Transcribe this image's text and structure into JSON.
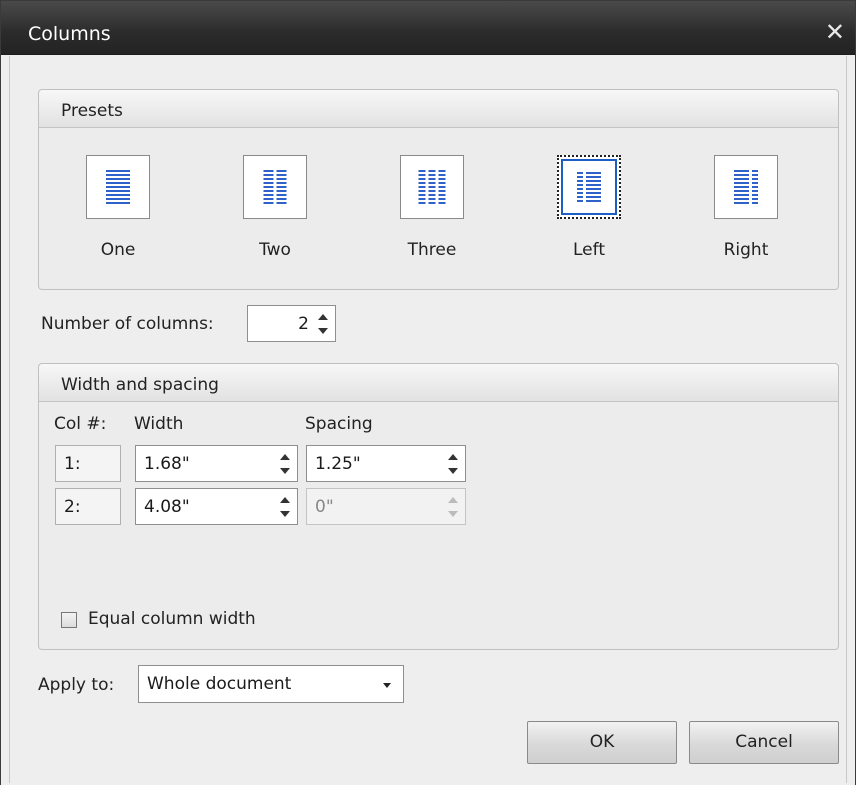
{
  "dialog": {
    "title": "Columns"
  },
  "presets": {
    "header": "Presets",
    "items": [
      {
        "label": "One",
        "icon": "one-column-icon"
      },
      {
        "label": "Two",
        "icon": "two-columns-icon"
      },
      {
        "label": "Three",
        "icon": "three-columns-icon"
      },
      {
        "label": "Left",
        "icon": "left-column-icon",
        "selected": true
      },
      {
        "label": "Right",
        "icon": "right-column-icon"
      }
    ]
  },
  "number_of_columns": {
    "label": "Number of columns:",
    "value": "2"
  },
  "width_spacing": {
    "header": "Width and spacing",
    "col_header": "Col #:",
    "width_header": "Width",
    "spacing_header": "Spacing",
    "rows": [
      {
        "col": "1:",
        "width": "1.68\"",
        "spacing": "1.25\""
      },
      {
        "col": "2:",
        "width": "4.08\"",
        "spacing": "0\""
      }
    ],
    "equal_width_label": "Equal column width",
    "equal_width_checked": false
  },
  "apply_to": {
    "label": "Apply to:",
    "value": "Whole document"
  },
  "buttons": {
    "ok": "OK",
    "cancel": "Cancel"
  },
  "colors": {
    "accent": "#2f62c8",
    "selection": "#1c5ec4",
    "titlebar": "#2b2b2b"
  }
}
